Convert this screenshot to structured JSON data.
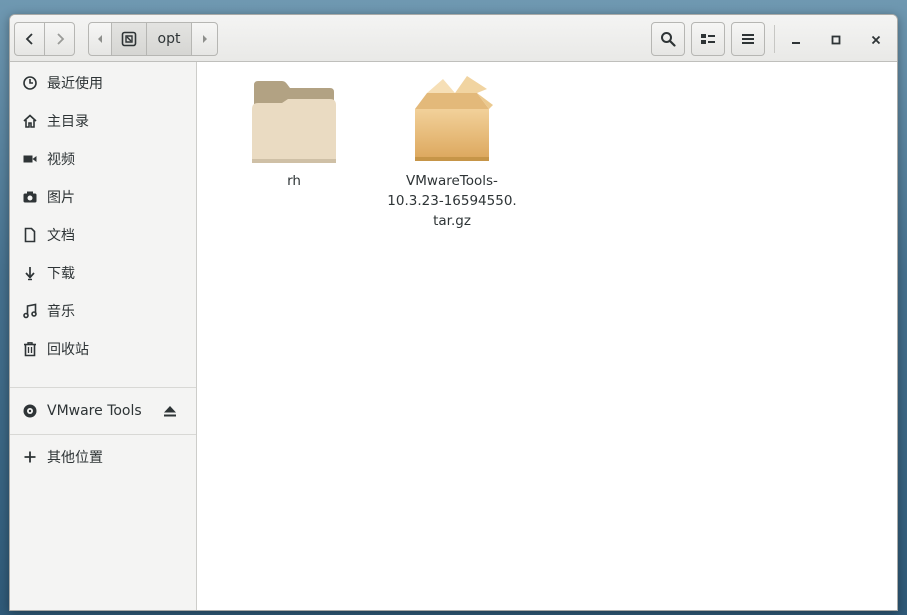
{
  "headerbar": {
    "path": {
      "current": "opt"
    }
  },
  "sidebar": {
    "items": [
      {
        "label": "最近使用",
        "icon": "recent-icon"
      },
      {
        "label": "主目录",
        "icon": "home-icon"
      },
      {
        "label": "视频",
        "icon": "video-icon"
      },
      {
        "label": "图片",
        "icon": "camera-icon"
      },
      {
        "label": "文档",
        "icon": "document-icon"
      },
      {
        "label": "下载",
        "icon": "download-icon"
      },
      {
        "label": "音乐",
        "icon": "music-icon"
      },
      {
        "label": "回收站",
        "icon": "trash-icon"
      }
    ],
    "devices": [
      {
        "label": "VMware Tools",
        "icon": "disc-icon",
        "action_icon": "eject-icon"
      }
    ],
    "other": {
      "label": "其他位置",
      "icon": "plus-icon"
    }
  },
  "files": [
    {
      "name": "rh",
      "icon": "folder-icon"
    },
    {
      "name_lines": [
        "VMwareTools-",
        "10.3.23-16594550.",
        "tar.gz"
      ],
      "icon": "package-icon"
    }
  ]
}
